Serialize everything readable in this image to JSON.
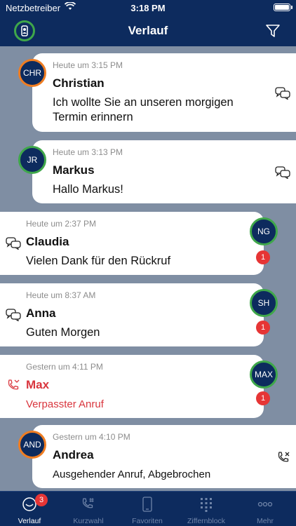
{
  "status_bar": {
    "carrier": "Netzbetreiber",
    "time": "3:18 PM"
  },
  "header": {
    "title": "Verlauf"
  },
  "history": [
    {
      "time": "Heute um 3:15 PM",
      "name": "Christian",
      "message": "Ich wollte Sie an unseren morgigen Termin erinnern",
      "initials": "CHR",
      "icon": "chat-icon",
      "side": "left",
      "ring": "orange"
    },
    {
      "time": "Heute um 3:13 PM",
      "name": "Markus",
      "message": "Hallo Markus!",
      "initials": "JR",
      "icon": "chat-icon",
      "side": "left",
      "ring": "green"
    },
    {
      "time": "Heute um 2:37 PM",
      "name": "Claudia",
      "message": "Vielen Dank für den Rückruf",
      "initials": "NG",
      "icon": "chat-icon",
      "side": "right",
      "ring": "green",
      "badge": "1"
    },
    {
      "time": "Heute um 8:37 AM",
      "name": "Anna",
      "message": "Guten Morgen",
      "initials": "SH",
      "icon": "chat-icon",
      "side": "right",
      "ring": "green",
      "badge": "1"
    },
    {
      "time": "Gestern um 4:11 PM",
      "name": "Max",
      "message": "Verpasster Anruf",
      "initials": "MAX",
      "icon": "missed-call-icon",
      "side": "right",
      "ring": "green",
      "badge": "1",
      "missed": true
    },
    {
      "time": "Gestern um 4:10 PM",
      "name": "Andrea",
      "message": "Ausgehender Anruf, Abgebrochen",
      "initials": "AND",
      "icon": "call-cancelled-icon",
      "side": "left",
      "ring": "orange"
    }
  ],
  "tabs": [
    {
      "label": "Verlauf",
      "icon": "history-icon",
      "badge": "3",
      "active": true
    },
    {
      "label": "Kurzwahl",
      "icon": "speed-dial-icon"
    },
    {
      "label": "Favoriten",
      "icon": "favorites-phone-icon"
    },
    {
      "label": "Ziffernblock",
      "icon": "keypad-icon"
    },
    {
      "label": "Mehr",
      "icon": "more-icon"
    }
  ],
  "colors": {
    "navy": "#0d2b5e",
    "orange_ring": "#ef7d22",
    "green_ring": "#3fa74a",
    "badge_red": "#e63535",
    "missed_red": "#d9363e"
  }
}
